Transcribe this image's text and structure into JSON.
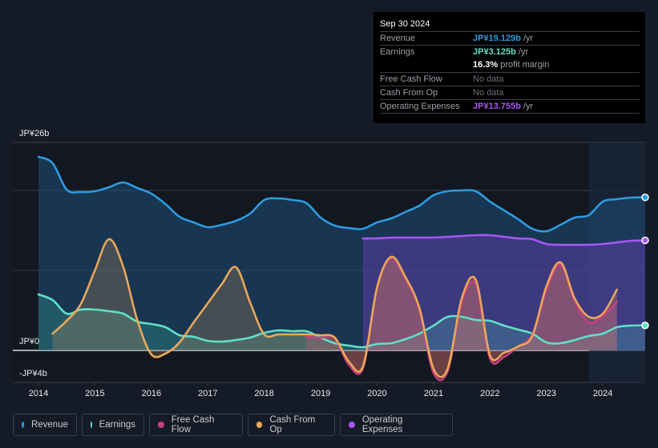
{
  "tooltip": {
    "date": "Sep 30 2024",
    "rows": [
      {
        "label": "Revenue",
        "value": "JP¥19.129b",
        "unit": " /yr",
        "color": "#2d9be0"
      },
      {
        "label": "Earnings",
        "value": "JP¥3.125b",
        "unit": " /yr",
        "color": "#5fe0c8"
      },
      {
        "label": "",
        "value": "16.3%",
        "unit": " profit margin",
        "color": "#ffffff"
      },
      {
        "label": "Free Cash Flow",
        "nodata": "No data"
      },
      {
        "label": "Cash From Op",
        "nodata": "No data"
      },
      {
        "label": "Operating Expenses",
        "value": "JP¥13.755b",
        "unit": " /yr",
        "color": "#a855f7"
      }
    ]
  },
  "legend": [
    {
      "label": "Revenue",
      "color": "#2d9be0"
    },
    {
      "label": "Earnings",
      "color": "#5fe0c8"
    },
    {
      "label": "Free Cash Flow",
      "color": "#c8407c"
    },
    {
      "label": "Cash From Op",
      "color": "#e8a85a"
    },
    {
      "label": "Operating Expenses",
      "color": "#a855f7"
    }
  ],
  "chart_data": {
    "type": "line",
    "title": "",
    "xlabel": "",
    "ylabel": "",
    "y_tick_labels": [
      {
        "value": 26,
        "label": "JP¥26b"
      },
      {
        "value": 0,
        "label": "JP¥0"
      },
      {
        "value": -4,
        "label": "-JP¥4b"
      }
    ],
    "ylim": [
      -4,
      26
    ],
    "gridlines_at": [
      26,
      20,
      10,
      0
    ],
    "xlim": [
      2014.0,
      2024.75
    ],
    "x_tick_labels": [
      "2014",
      "2015",
      "2016",
      "2017",
      "2018",
      "2019",
      "2020",
      "2021",
      "2022",
      "2023",
      "2024"
    ],
    "forecast_shade_start": 2023.75,
    "series": [
      {
        "name": "Revenue",
        "color": "#2d9be0",
        "x": [
          2014.0,
          2014.25,
          2014.5,
          2014.75,
          2015.0,
          2015.25,
          2015.5,
          2015.75,
          2016.0,
          2016.25,
          2016.5,
          2016.75,
          2017.0,
          2017.25,
          2017.5,
          2017.75,
          2018.0,
          2018.25,
          2018.5,
          2018.75,
          2019.0,
          2019.25,
          2019.5,
          2019.75,
          2020.0,
          2020.25,
          2020.5,
          2020.75,
          2021.0,
          2021.25,
          2021.5,
          2021.75,
          2022.0,
          2022.25,
          2022.5,
          2022.75,
          2023.0,
          2023.25,
          2023.5,
          2023.75,
          2024.0,
          2024.25,
          2024.5,
          2024.75
        ],
        "y": [
          24.2,
          23.4,
          20.1,
          19.8,
          19.9,
          20.4,
          21.0,
          20.3,
          19.6,
          18.3,
          16.7,
          16.0,
          15.4,
          15.7,
          16.2,
          17.1,
          18.8,
          19.0,
          18.8,
          18.4,
          16.6,
          15.6,
          15.3,
          15.2,
          16.0,
          16.5,
          17.3,
          18.1,
          19.4,
          19.9,
          20.0,
          19.9,
          18.6,
          17.5,
          16.4,
          15.2,
          14.9,
          15.7,
          16.6,
          16.9,
          18.6,
          18.9,
          19.1,
          19.13
        ]
      },
      {
        "name": "Earnings",
        "color": "#5fe0c8",
        "x": [
          2014.0,
          2014.25,
          2014.5,
          2014.75,
          2015.0,
          2015.25,
          2015.5,
          2015.75,
          2016.0,
          2016.25,
          2016.5,
          2016.75,
          2017.0,
          2017.25,
          2017.5,
          2017.75,
          2018.0,
          2018.25,
          2018.5,
          2018.75,
          2019.0,
          2019.25,
          2019.5,
          2019.75,
          2020.0,
          2020.25,
          2020.5,
          2020.75,
          2021.0,
          2021.25,
          2021.5,
          2021.75,
          2022.0,
          2022.25,
          2022.5,
          2022.75,
          2023.0,
          2023.25,
          2023.5,
          2023.75,
          2024.0,
          2024.25,
          2024.5,
          2024.75
        ],
        "y": [
          7.0,
          6.3,
          4.6,
          5.1,
          5.1,
          4.9,
          4.6,
          3.6,
          3.3,
          2.9,
          1.9,
          1.7,
          1.2,
          1.1,
          1.3,
          1.6,
          2.2,
          2.5,
          2.4,
          2.4,
          1.6,
          0.9,
          0.6,
          0.4,
          0.8,
          0.9,
          1.4,
          2.1,
          3.1,
          4.2,
          4.2,
          3.8,
          3.7,
          3.1,
          2.6,
          2.1,
          1.0,
          0.9,
          1.3,
          1.8,
          2.1,
          2.9,
          3.1,
          3.125
        ]
      },
      {
        "name": "Free Cash Flow",
        "color": "#c8407c",
        "x": [
          2018.75,
          2019.0,
          2019.25,
          2019.5,
          2019.75,
          2020.0,
          2020.25,
          2020.5,
          2020.75,
          2021.0,
          2021.25,
          2021.5,
          2021.75,
          2022.0,
          2022.25,
          2022.5,
          2022.75,
          2023.0,
          2023.25,
          2023.5,
          2023.75,
          2024.0,
          2024.25
        ],
        "y": [
          1.7,
          1.6,
          1.5,
          -1.8,
          -2.2,
          7.8,
          11.5,
          9.0,
          5.0,
          -2.8,
          -2.6,
          6.0,
          8.2,
          -1.0,
          -0.8,
          0.5,
          2.0,
          7.5,
          10.7,
          6.2,
          3.5,
          4.3,
          6.1
        ]
      },
      {
        "name": "Cash From Op",
        "color": "#e8a85a",
        "x": [
          2014.25,
          2014.5,
          2014.75,
          2015.0,
          2015.25,
          2015.5,
          2015.75,
          2016.0,
          2016.25,
          2016.5,
          2016.75,
          2017.0,
          2017.25,
          2017.5,
          2017.75,
          2018.0,
          2018.25,
          2018.5,
          2018.75,
          2019.0,
          2019.25,
          2019.5,
          2019.75,
          2020.0,
          2020.25,
          2020.5,
          2020.75,
          2021.0,
          2021.25,
          2021.5,
          2021.75,
          2022.0,
          2022.25,
          2022.5,
          2022.75,
          2023.0,
          2023.25,
          2023.5,
          2023.75,
          2024.0,
          2024.25
        ],
        "y": [
          2.1,
          3.7,
          5.8,
          10.0,
          13.9,
          10.5,
          3.8,
          -0.5,
          -0.4,
          1.0,
          3.5,
          5.9,
          8.3,
          10.4,
          6.0,
          2.0,
          2.0,
          2.0,
          2.0,
          1.9,
          1.6,
          -1.4,
          -2.0,
          7.9,
          11.7,
          9.2,
          5.3,
          -2.3,
          -2.3,
          6.5,
          8.8,
          -0.6,
          -0.3,
          0.5,
          1.8,
          8.0,
          11.0,
          6.5,
          4.2,
          4.6,
          7.6
        ]
      },
      {
        "name": "Operating Expenses",
        "color": "#a855f7",
        "x": [
          2019.75,
          2020.0,
          2020.25,
          2020.5,
          2020.75,
          2021.0,
          2021.25,
          2021.5,
          2021.75,
          2022.0,
          2022.25,
          2022.5,
          2022.75,
          2023.0,
          2023.25,
          2023.5,
          2023.75,
          2024.0,
          2024.25,
          2024.5,
          2024.75
        ],
        "y": [
          14.0,
          14.0,
          14.1,
          14.1,
          14.1,
          14.1,
          14.2,
          14.3,
          14.4,
          14.4,
          14.2,
          14.0,
          13.9,
          13.3,
          13.2,
          13.2,
          13.2,
          13.3,
          13.5,
          13.7,
          13.755
        ]
      }
    ]
  }
}
